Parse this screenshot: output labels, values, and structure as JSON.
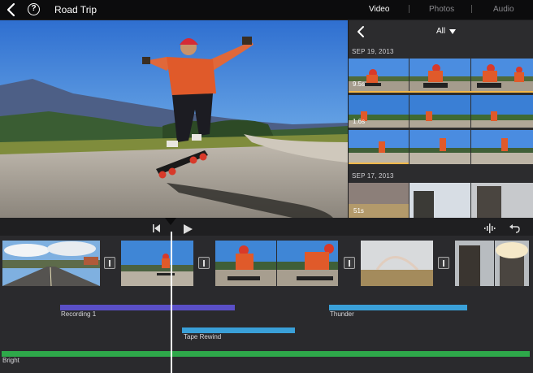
{
  "header": {
    "project_title": "Road Trip",
    "tabs": [
      {
        "label": "Video",
        "active": true
      },
      {
        "label": "Photos",
        "active": false
      },
      {
        "label": "Audio",
        "active": false
      }
    ],
    "help_glyph": "?"
  },
  "browser": {
    "filter_label": "All",
    "groups": [
      {
        "date": "SEP 19, 2013",
        "durations": [
          "9.5s",
          "1.6s"
        ]
      },
      {
        "date": "SEP 17, 2013",
        "durations": [
          "51s"
        ]
      }
    ]
  },
  "timeline": {
    "audio_tracks": [
      {
        "label": "Recording 1",
        "color": "#5a4fc7"
      },
      {
        "label": "Thunder",
        "color": "#3aa0d8"
      },
      {
        "label": "Tape Rewind",
        "color": "#3aa0d8"
      },
      {
        "label": "Bright",
        "color": "#2ea84a"
      }
    ]
  },
  "colors": {
    "accent_purple": "#5a4fc7",
    "accent_blue": "#3aa0d8",
    "accent_green": "#2ea84a",
    "sky": "#3f86d6"
  },
  "icons": [
    "back-chevron-icon",
    "help-icon",
    "skip-back-icon",
    "play-icon",
    "waveform-icon",
    "undo-icon",
    "transition-icon"
  ]
}
